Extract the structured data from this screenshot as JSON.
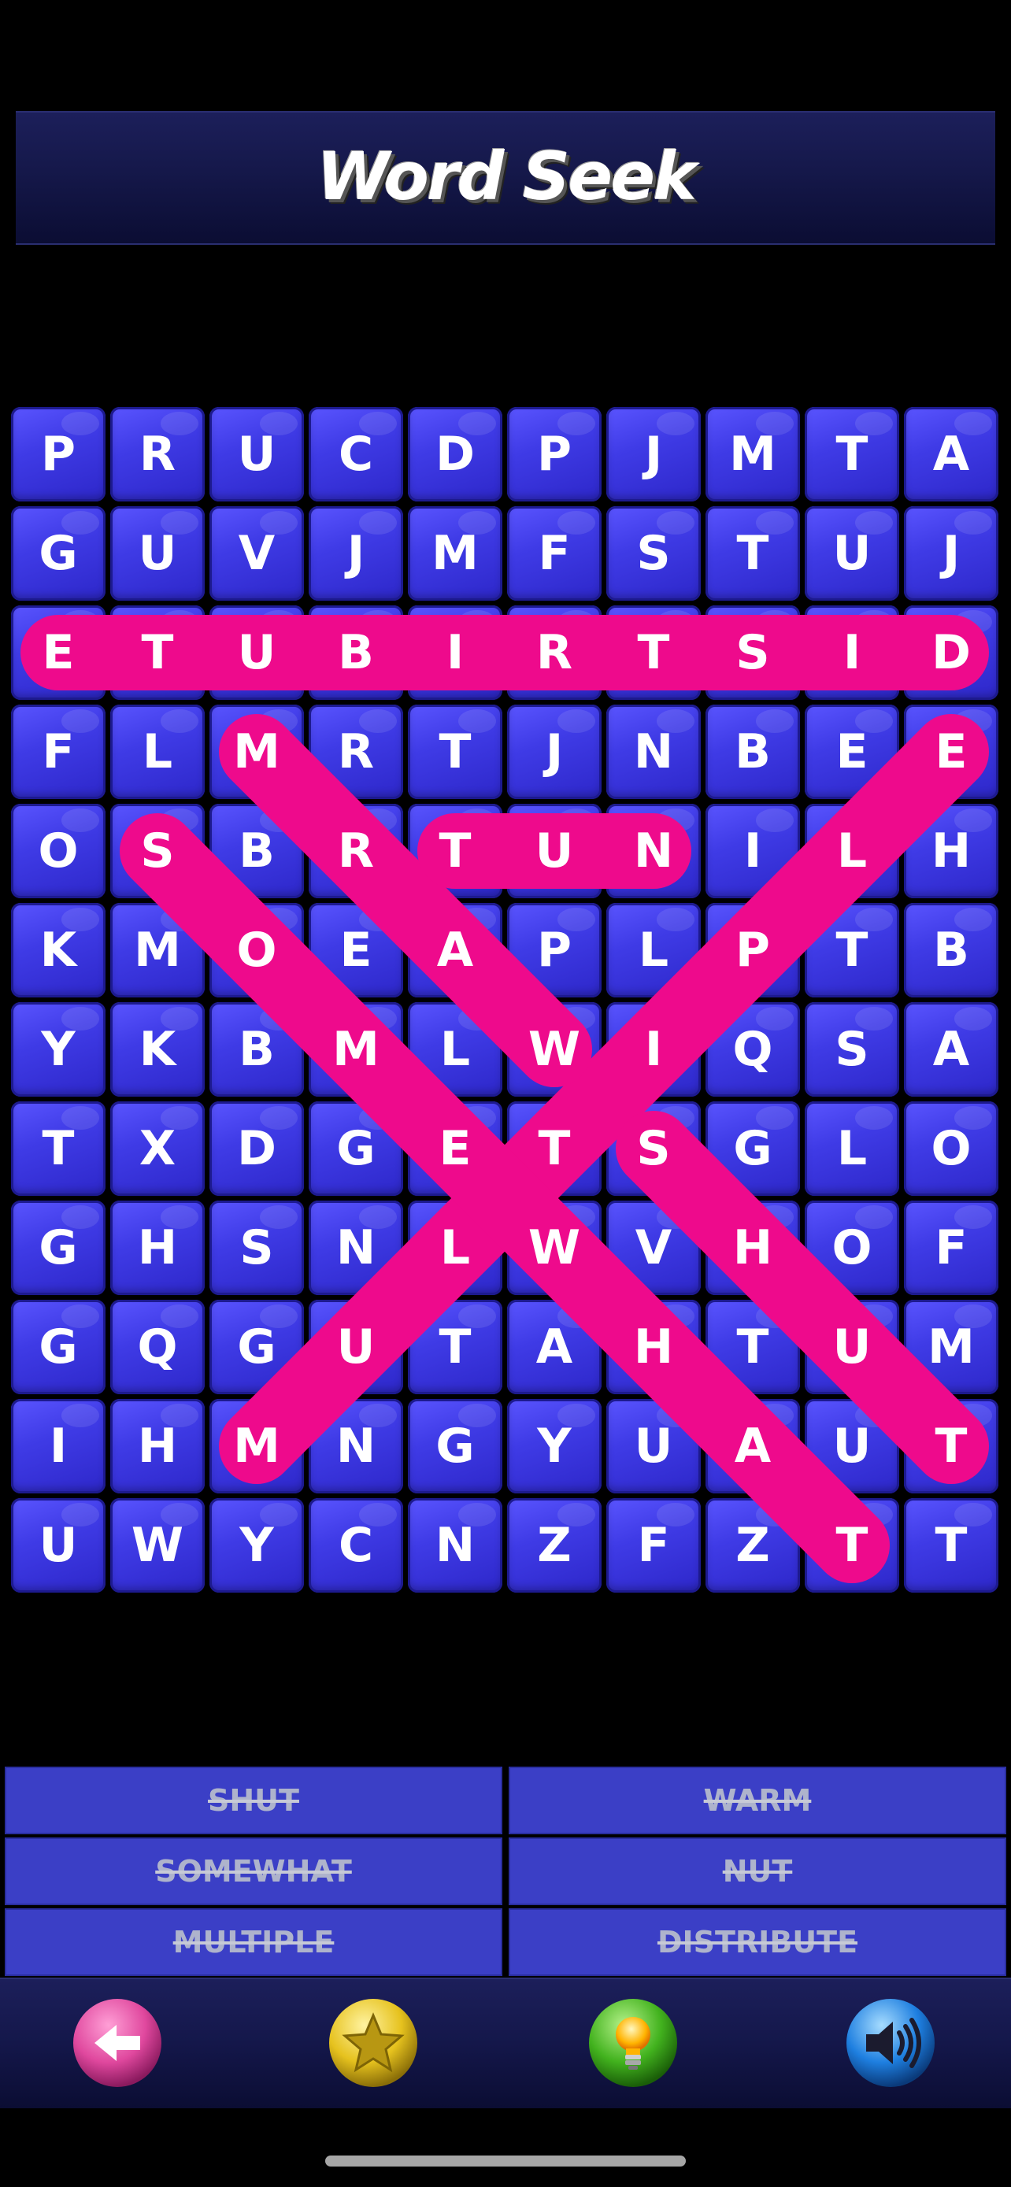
{
  "header": {
    "title": "Word Seek"
  },
  "grid": {
    "rows": [
      [
        "P",
        "R",
        "U",
        "C",
        "D",
        "P",
        "J",
        "M",
        "T",
        "A"
      ],
      [
        "G",
        "U",
        "V",
        "J",
        "M",
        "F",
        "S",
        "T",
        "U",
        "J"
      ],
      [
        "E",
        "T",
        "U",
        "B",
        "I",
        "R",
        "T",
        "S",
        "I",
        "D"
      ],
      [
        "F",
        "L",
        "M",
        "R",
        "T",
        "J",
        "N",
        "B",
        "E",
        "E"
      ],
      [
        "O",
        "S",
        "B",
        "R",
        "T",
        "U",
        "N",
        "I",
        "L",
        "H"
      ],
      [
        "K",
        "M",
        "O",
        "E",
        "A",
        "P",
        "L",
        "P",
        "T",
        "B"
      ],
      [
        "Y",
        "K",
        "B",
        "M",
        "L",
        "W",
        "I",
        "Q",
        "S",
        "A"
      ],
      [
        "T",
        "X",
        "D",
        "G",
        "E",
        "T",
        "S",
        "G",
        "L",
        "O"
      ],
      [
        "G",
        "H",
        "S",
        "N",
        "L",
        "W",
        "V",
        "H",
        "O",
        "F"
      ],
      [
        "G",
        "Q",
        "G",
        "U",
        "T",
        "A",
        "H",
        "T",
        "U",
        "M"
      ],
      [
        "I",
        "H",
        "M",
        "N",
        "G",
        "Y",
        "U",
        "A",
        "U",
        "T"
      ],
      [
        "U",
        "W",
        "Y",
        "C",
        "N",
        "Z",
        "F",
        "Z",
        "T",
        "T"
      ]
    ],
    "found": [
      {
        "word": "DISTRIBUTE",
        "from": [
          2,
          9
        ],
        "to": [
          2,
          0
        ]
      },
      {
        "word": "MULTIPLE",
        "from": [
          10,
          2
        ],
        "to": [
          3,
          9
        ]
      },
      {
        "word": "SOMEWHAT",
        "from": [
          4,
          1
        ],
        "to": [
          11,
          8
        ]
      },
      {
        "word": "WARM",
        "from": [
          6,
          5
        ],
        "to": [
          3,
          2
        ]
      },
      {
        "word": "NUT",
        "from": [
          4,
          6
        ],
        "to": [
          4,
          4
        ]
      },
      {
        "word": "SHUT",
        "from": [
          7,
          6
        ],
        "to": [
          10,
          9
        ]
      }
    ],
    "highlight_color": "#ee0a8c"
  },
  "words": [
    {
      "label": "SHUT",
      "found": true
    },
    {
      "label": "WARM",
      "found": true
    },
    {
      "label": "SOMEWHAT",
      "found": true
    },
    {
      "label": "NUT",
      "found": true
    },
    {
      "label": "MULTIPLE",
      "found": true
    },
    {
      "label": "DISTRIBUTE",
      "found": true
    }
  ],
  "toolbar": {
    "buttons": [
      {
        "name": "back-button",
        "icon": "arrow-left-icon",
        "color": "#e0489e"
      },
      {
        "name": "favorite-button",
        "icon": "star-icon",
        "color": "#e6c21e"
      },
      {
        "name": "hint-button",
        "icon": "lightbulb-icon",
        "color": "#42b21e"
      },
      {
        "name": "sound-button",
        "icon": "speaker-icon",
        "color": "#1e7fe0"
      }
    ]
  }
}
